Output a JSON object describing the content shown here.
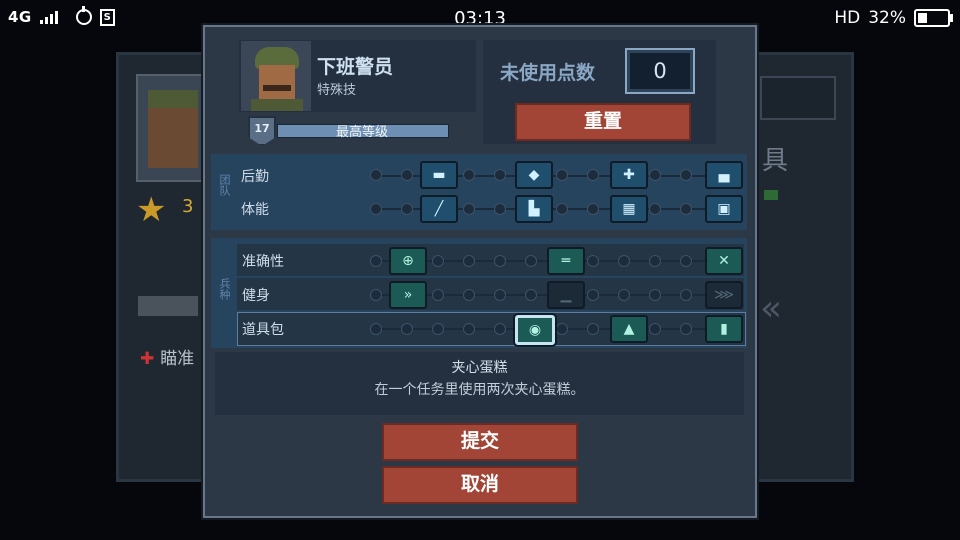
{
  "status_bar": {
    "network": "4G",
    "time": "03:13",
    "hd": "HD",
    "battery": "32%",
    "battery_level": 0.32
  },
  "background": {
    "star_count": "3",
    "aim_label": "瞄准",
    "right_text": "具"
  },
  "header": {
    "name": "下班警员",
    "rank": "特殊技",
    "level": "17",
    "level_label": "最高等级",
    "level_progress": 1.0
  },
  "points": {
    "label": "未使用点数",
    "value": "0",
    "reset_label": "重置"
  },
  "sections": [
    {
      "side_label": "团队",
      "rows": [
        {
          "label": "后勤",
          "icons": [
            "truck-icon",
            "shield-plus-icon",
            "medkit-icon",
            "bed-icon"
          ],
          "selected": null,
          "green": []
        },
        {
          "label": "体能",
          "icons": [
            "knife-icon",
            "boot-icon",
            "crate-icon",
            "armor-icon"
          ],
          "selected": null,
          "green": []
        }
      ]
    },
    {
      "side_label": "兵种",
      "rows": [
        {
          "label": "准确性",
          "icons": [
            "scope-icon",
            "rifle-icon",
            "crossfire-icon"
          ],
          "selected": null,
          "green": [
            0,
            1,
            2
          ]
        },
        {
          "label": "健身",
          "icons": [
            "dash-icon",
            "prone-icon",
            "sprint-icon"
          ],
          "selected": null,
          "green": [
            0
          ]
        },
        {
          "label": "道具包",
          "icons": [
            "cake-icon",
            "bag-icon",
            "ammo-icon"
          ],
          "selected": 0,
          "green": [
            0,
            1,
            2
          ]
        }
      ]
    }
  ],
  "description": {
    "title": "夹心蛋糕",
    "text": "在一个任务里使用两次夹心蛋糕。"
  },
  "buttons": {
    "submit": "提交",
    "cancel": "取消"
  },
  "colors": {
    "accent_red": "#a34536",
    "panel": "#2c3846",
    "section_blue": "#27445f"
  }
}
